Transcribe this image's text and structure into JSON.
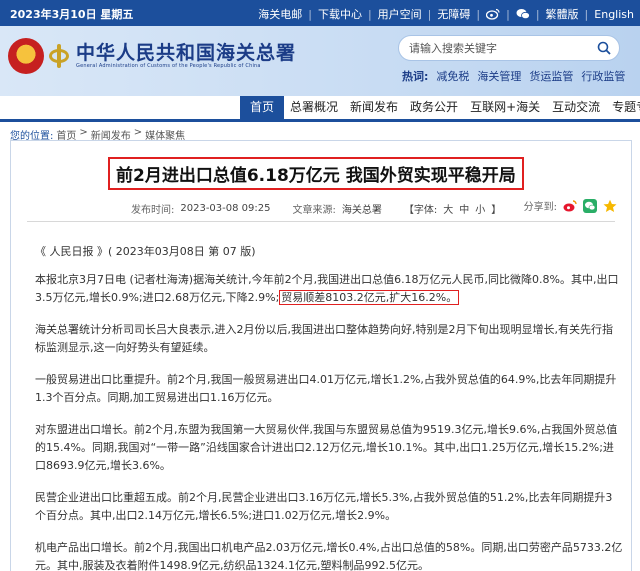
{
  "topbar": {
    "date": "2023年3月10日 星期五",
    "links": [
      "海关电邮",
      "下载中心",
      "用户空间",
      "无障碍"
    ],
    "language_traditional": "繁體版",
    "language_english": "English"
  },
  "header": {
    "title": "中华人民共和国海关总署",
    "subtitle": "General Administration of Customs of the People's Republic of China",
    "search_placeholder": "请输入搜索关键字",
    "hot_label": "热词:",
    "hot_words": [
      "减免税",
      "海关管理",
      "货运监管",
      "行政监管"
    ]
  },
  "nav": {
    "items": [
      "首页",
      "总署概况",
      "新闻发布",
      "政务公开",
      "互联网+海关",
      "互动交流",
      "专题专栏"
    ]
  },
  "breadcrumb": {
    "label": "您的位置:",
    "items": [
      "首页",
      "新闻发布",
      "媒体聚焦"
    ],
    "separator": ">"
  },
  "article": {
    "title": "前2月进出口总值6.18万亿元 我国外贸实现平稳开局",
    "meta": {
      "published_label": "发布时间:",
      "published": "2023-03-08 09:25",
      "source_label": "文章来源:",
      "source": "海关总署",
      "font_label": "【字体:",
      "font_large": "大",
      "font_medium": "中",
      "font_small": "小",
      "font_end": "】",
      "share_label": "分享到:"
    },
    "paragraphs": {
      "source_line": "《 人民日报 》( 2023年03月08日  第 07 版)",
      "p1_a": "本报北京3月7日电 (记者杜海涛)据海关统计,今年前2个月,我国进出口总值6.18万亿元人民币,同比微降0.8%。其中,出口3.5万亿元,增长0.9%;进口2.68万亿元,下降2.9%;",
      "p1_hl": "贸易顺差8103.2亿元,扩大16.2%。",
      "p2": "海关总署统计分析司司长吕大良表示,进入2月份以后,我国进出口整体趋势向好,特别是2月下旬出现明显增长,有关先行指标监测显示,这一向好势头有望延续。",
      "p3": "一般贸易进出口比重提升。前2个月,我国一般贸易进出口4.01万亿元,增长1.2%,占我外贸总值的64.9%,比去年同期提升1.3个百分点。同期,加工贸易进出口1.16万亿元。",
      "p4": "对东盟进出口增长。前2个月,东盟为我国第一大贸易伙伴,我国与东盟贸易总值为9519.3亿元,增长9.6%,占我国外贸总值的15.4%。同期,我国对“一带一路”沿线国家合计进出口2.12万亿元,增长10.1%。其中,出口1.25万亿元,增长15.2%;进口8693.9亿元,增长3.6%。",
      "p5": "民营企业进出口比重超五成。前2个月,民营企业进出口3.16万亿元,增长5.3%,占我外贸总值的51.2%,比去年同期提升3个百分点。其中,出口2.14万亿元,增长6.5%;进口1.02万亿元,增长2.9%。",
      "p6": "机电产品出口增长。前2个月,我国出口机电产品2.03万亿元,增长0.4%,占出口总值的58%。同期,出口劳密产品5733.2亿元。其中,服装及衣着附件1498.9亿元,纺织品1324.1亿元,塑料制品992.5亿元。"
    }
  },
  "colors": {
    "brand_blue": "#1c4f9c",
    "highlight_red": "#e02020"
  }
}
